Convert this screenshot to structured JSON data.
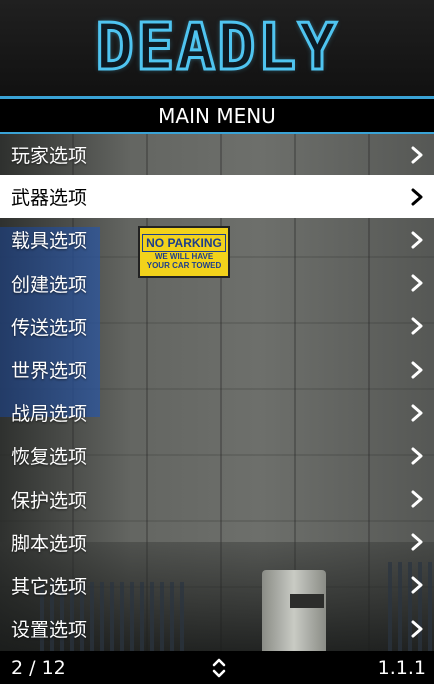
{
  "header": {
    "logo_text": "DEADLY",
    "accent_color": "#3aa3d6"
  },
  "menu": {
    "title": "MAIN MENU",
    "items": [
      {
        "label": "玩家选项"
      },
      {
        "label": "武器选项"
      },
      {
        "label": "载具选项"
      },
      {
        "label": "创建选项"
      },
      {
        "label": "传送选项"
      },
      {
        "label": "世界选项"
      },
      {
        "label": "战局选项"
      },
      {
        "label": "恢复选项"
      },
      {
        "label": "保护选项"
      },
      {
        "label": "脚本选项"
      },
      {
        "label": "其它选项"
      },
      {
        "label": "设置选项"
      }
    ],
    "selected_index": 1
  },
  "footer": {
    "position": "2 / 12",
    "version": "1.1.1",
    "scroll_icon": "up-down-arrows-icon"
  },
  "background": {
    "sign_line1": "NO PARKING",
    "sign_line2": "WE WILL HAVE",
    "sign_line3": "YOUR CAR TOWED"
  }
}
